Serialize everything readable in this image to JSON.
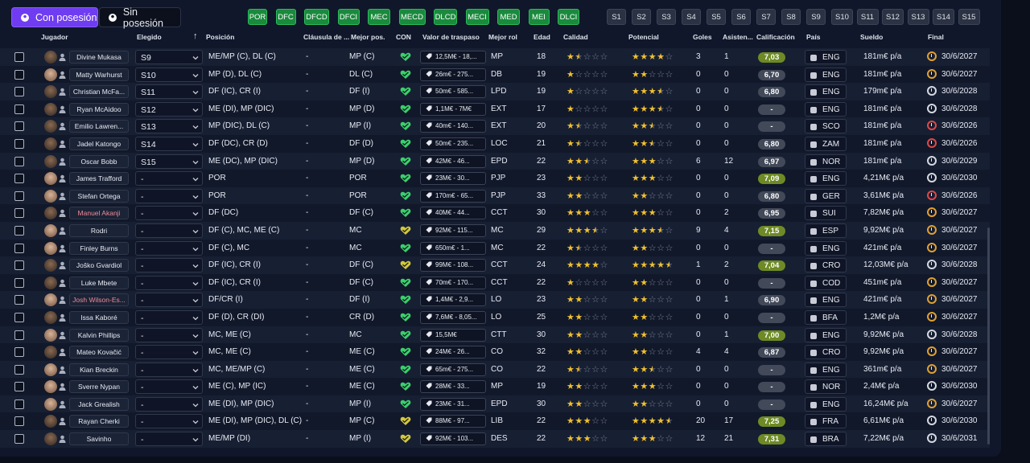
{
  "tabs": {
    "with_ball": "Con posesión",
    "without_ball": "Sin posesión"
  },
  "position_filters": [
    "POR",
    "DFC",
    "DFCD",
    "DFCI",
    "MEC",
    "MECD",
    "DLCD",
    "MECI",
    "MED",
    "MEI",
    "DLCI"
  ],
  "slot_filters": [
    "S1",
    "S2",
    "S3",
    "S4",
    "S5",
    "S6",
    "S7",
    "S8",
    "S9",
    "S10",
    "S11",
    "S12",
    "S13",
    "S14",
    "S15"
  ],
  "columns": {
    "player": "Jugador",
    "chosen": "Elegido",
    "position": "Posición",
    "clause": "Cláusula de ...",
    "best_pos": "Mejor pos.",
    "con": "CON",
    "value": "Valor de traspaso",
    "best_role": "Mejor rol",
    "age": "Edad",
    "quality": "Calidad",
    "potential": "Potencial",
    "goals": "Goles",
    "assists": "Asisten...",
    "rating": "Calificación",
    "country": "País",
    "wage": "Sueldo",
    "end": "Final"
  },
  "colors": {
    "accent": "#6f3cf1",
    "filter_green": "#1a8a3d",
    "heart_green": "#3ad06a",
    "heart_yellow": "#d2c83a",
    "star_gold": "#f0c030"
  },
  "players": [
    {
      "name": "Divine Mukasa",
      "chosen": "S9",
      "pos": "ME/MP (C), DL (C)",
      "clause": "-",
      "best": "MP (C)",
      "value": "12,5M€ - 18,...",
      "role": "MP",
      "age": "18",
      "q": "★½☆☆☆",
      "p": "★★★★☆",
      "g": "3",
      "a": "1",
      "rating": "7,03",
      "rc": "lime",
      "country": "ENG",
      "wage": "181m€ p/a",
      "end": "30/6/2027",
      "ec": "warn",
      "heart": "green",
      "light": false,
      "red": false
    },
    {
      "name": "Matty Warhurst",
      "chosen": "S10",
      "pos": "MP (D), DL (C)",
      "clause": "-",
      "best": "DL (C)",
      "value": "26m€ - 275...",
      "role": "DB",
      "age": "19",
      "q": "★☆☆☆☆",
      "p": "★★☆☆☆",
      "g": "0",
      "a": "0",
      "rating": "6,70",
      "rc": "gray",
      "country": "ENG",
      "wage": "181m€ p/a",
      "end": "30/6/2027",
      "ec": "warn",
      "heart": "green",
      "light": true,
      "red": false
    },
    {
      "name": "Christian McFa...",
      "chosen": "S11",
      "pos": "DF (IC), CR (I)",
      "clause": "-",
      "best": "DF (I)",
      "value": "50m€ - 585...",
      "role": "LPD",
      "age": "19",
      "q": "★☆☆☆☆",
      "p": "★★★½☆",
      "g": "0",
      "a": "0",
      "rating": "6,80",
      "rc": "gray",
      "country": "ENG",
      "wage": "179m€ p/a",
      "end": "30/6/2028",
      "ec": "",
      "heart": "green",
      "light": false,
      "red": false
    },
    {
      "name": "Ryan McAidoo",
      "chosen": "S12",
      "pos": "ME (DI), MP (DIC)",
      "clause": "-",
      "best": "MP (D)",
      "value": "1,1M€ - 7M€",
      "role": "EXT",
      "age": "17",
      "q": "★☆☆☆☆",
      "p": "★★★½☆",
      "g": "0",
      "a": "0",
      "rating": "-",
      "rc": "gray",
      "country": "ENG",
      "wage": "181m€ p/a",
      "end": "30/6/2028",
      "ec": "",
      "heart": "green",
      "light": false,
      "red": false
    },
    {
      "name": "Emilio Lawren...",
      "chosen": "S13",
      "pos": "MP (DIC), DL (C)",
      "clause": "-",
      "best": "MP (I)",
      "value": "40m€ - 140...",
      "role": "EXT",
      "age": "20",
      "q": "★½☆☆☆",
      "p": "★★½☆☆",
      "g": "0",
      "a": "0",
      "rating": "-",
      "rc": "gray",
      "country": "SCO",
      "wage": "181m€ p/a",
      "end": "30/6/2026",
      "ec": "bad",
      "heart": "green",
      "light": false,
      "red": false
    },
    {
      "name": "Jadel Katongo",
      "chosen": "S14",
      "pos": "DF (DC), CR (D)",
      "clause": "-",
      "best": "DF (D)",
      "value": "50m€ - 235...",
      "role": "LOC",
      "age": "21",
      "q": "★½☆☆☆",
      "p": "★★½☆☆",
      "g": "0",
      "a": "0",
      "rating": "6,80",
      "rc": "gray",
      "country": "ZAM",
      "wage": "181m€ p/a",
      "end": "30/6/2026",
      "ec": "bad",
      "heart": "green",
      "light": false,
      "red": false
    },
    {
      "name": "Oscar Bobb",
      "chosen": "S15",
      "pos": "ME (DC), MP (DIC)",
      "clause": "-",
      "best": "MP (D)",
      "value": "42M€ - 46...",
      "role": "EPD",
      "age": "22",
      "q": "★★½☆☆",
      "p": "★★★☆☆",
      "g": "6",
      "a": "12",
      "rating": "6,97",
      "rc": "gray",
      "country": "NOR",
      "wage": "181m€ p/a",
      "end": "30/6/2029",
      "ec": "",
      "heart": "green",
      "light": false,
      "red": false
    },
    {
      "name": "James Trafford",
      "chosen": "-",
      "pos": "POR",
      "clause": "-",
      "best": "POR",
      "value": "23M€ - 30...",
      "role": "PJP",
      "age": "23",
      "q": "★★☆☆☆",
      "p": "★★★☆☆",
      "g": "0",
      "a": "0",
      "rating": "7,09",
      "rc": "lime",
      "country": "ENG",
      "wage": "4,21M€ p/a",
      "end": "30/6/2030",
      "ec": "",
      "heart": "green",
      "light": true,
      "red": false
    },
    {
      "name": "Stefan Ortega",
      "chosen": "-",
      "pos": "POR",
      "clause": "-",
      "best": "POR",
      "value": "170m€ - 65...",
      "role": "PJP",
      "age": "33",
      "q": "★★☆☆☆",
      "p": "★★☆☆☆",
      "g": "0",
      "a": "0",
      "rating": "6,80",
      "rc": "gray",
      "country": "GER",
      "wage": "3,61M€ p/a",
      "end": "30/6/2026",
      "ec": "bad",
      "heart": "green",
      "light": true,
      "red": false
    },
    {
      "name": "Manuel Akanji",
      "chosen": "-",
      "pos": "DF (DC)",
      "clause": "-",
      "best": "DF (C)",
      "value": "40M€ - 44...",
      "role": "CCT",
      "age": "30",
      "q": "★★★☆☆",
      "p": "★★★☆☆",
      "g": "0",
      "a": "2",
      "rating": "6,95",
      "rc": "gray",
      "country": "SUI",
      "wage": "7,82M€ p/a",
      "end": "30/6/2027",
      "ec": "warn",
      "heart": "green",
      "light": false,
      "red": true
    },
    {
      "name": "Rodri",
      "chosen": "-",
      "pos": "DF (C), MC, ME (C)",
      "clause": "-",
      "best": "MC",
      "value": "92M€ - 115...",
      "role": "MC",
      "age": "29",
      "q": "★★★½☆",
      "p": "★★★½☆",
      "g": "9",
      "a": "4",
      "rating": "7,15",
      "rc": "lime",
      "country": "ESP",
      "wage": "9,92M€ p/a",
      "end": "30/6/2027",
      "ec": "warn",
      "heart": "yellow",
      "light": true,
      "red": false
    },
    {
      "name": "Finley Burns",
      "chosen": "-",
      "pos": "DF (C), MC",
      "clause": "-",
      "best": "MC",
      "value": "650m€ - 1...",
      "role": "MC",
      "age": "22",
      "q": "★½☆☆☆",
      "p": "★★☆☆☆",
      "g": "0",
      "a": "0",
      "rating": "-",
      "rc": "gray",
      "country": "ENG",
      "wage": "421m€ p/a",
      "end": "30/6/2027",
      "ec": "warn",
      "heart": "green",
      "light": true,
      "red": false
    },
    {
      "name": "Joško Gvardiol",
      "chosen": "-",
      "pos": "DF (IC), CR (I)",
      "clause": "-",
      "best": "DF (C)",
      "value": "99M€ - 108...",
      "role": "CCT",
      "age": "24",
      "q": "★★★★☆",
      "p": "★★★★½",
      "g": "1",
      "a": "2",
      "rating": "7,04",
      "rc": "lime",
      "country": "CRO",
      "wage": "12,03M€ p/a",
      "end": "30/6/2028",
      "ec": "",
      "heart": "yellow",
      "light": false,
      "red": false
    },
    {
      "name": "Luke Mbete",
      "chosen": "-",
      "pos": "DF (IC), CR (I)",
      "clause": "-",
      "best": "DF (C)",
      "value": "70m€ - 170...",
      "role": "CCT",
      "age": "22",
      "q": "★☆☆☆☆",
      "p": "★★☆☆☆",
      "g": "0",
      "a": "0",
      "rating": "-",
      "rc": "gray",
      "country": "COD",
      "wage": "451m€ p/a",
      "end": "30/6/2027",
      "ec": "warn",
      "heart": "green",
      "light": false,
      "red": false
    },
    {
      "name": "Josh Wilson-Es...",
      "chosen": "-",
      "pos": "DF/CR (I)",
      "clause": "-",
      "best": "DF (I)",
      "value": "1,4M€ - 2,9...",
      "role": "LO",
      "age": "23",
      "q": "★★☆☆☆",
      "p": "★★☆☆☆",
      "g": "0",
      "a": "1",
      "rating": "6,90",
      "rc": "gray",
      "country": "ENG",
      "wage": "421m€ p/a",
      "end": "30/6/2027",
      "ec": "warn",
      "heart": "green",
      "light": true,
      "red": true
    },
    {
      "name": "Issa Kaboré",
      "chosen": "-",
      "pos": "DF (D), CR (DI)",
      "clause": "-",
      "best": "CR (D)",
      "value": "7,6M€ - 8,05...",
      "role": "LO",
      "age": "25",
      "q": "★★☆☆☆",
      "p": "★★☆☆☆",
      "g": "0",
      "a": "0",
      "rating": "-",
      "rc": "gray",
      "country": "BFA",
      "wage": "1,2M€ p/a",
      "end": "30/6/2027",
      "ec": "warn",
      "heart": "green",
      "light": false,
      "red": false
    },
    {
      "name": "Kalvin Phillips",
      "chosen": "-",
      "pos": "MC, ME (C)",
      "clause": "-",
      "best": "MC",
      "value": "15,5M€",
      "role": "CTT",
      "age": "30",
      "q": "★★☆☆☆",
      "p": "★★☆☆☆",
      "g": "0",
      "a": "1",
      "rating": "7,00",
      "rc": "lime",
      "country": "ENG",
      "wage": "9,92M€ p/a",
      "end": "30/6/2028",
      "ec": "",
      "heart": "green",
      "light": true,
      "red": false
    },
    {
      "name": "Mateo Kovačić",
      "chosen": "-",
      "pos": "MC, ME (C)",
      "clause": "-",
      "best": "ME (C)",
      "value": "24M€ - 26...",
      "role": "CO",
      "age": "32",
      "q": "★★☆☆☆",
      "p": "★★☆☆☆",
      "g": "4",
      "a": "4",
      "rating": "6,87",
      "rc": "gray",
      "country": "CRO",
      "wage": "9,92M€ p/a",
      "end": "30/6/2027",
      "ec": "warn",
      "heart": "green",
      "light": false,
      "red": false
    },
    {
      "name": "Kian Breckin",
      "chosen": "-",
      "pos": "MC, ME/MP (C)",
      "clause": "-",
      "best": "ME (C)",
      "value": "65m€ - 275...",
      "role": "CO",
      "age": "22",
      "q": "★½☆☆☆",
      "p": "★★½☆☆",
      "g": "0",
      "a": "0",
      "rating": "-",
      "rc": "gray",
      "country": "ENG",
      "wage": "361m€ p/a",
      "end": "30/6/2027",
      "ec": "warn",
      "heart": "green",
      "light": true,
      "red": false
    },
    {
      "name": "Sverre Nypan",
      "chosen": "-",
      "pos": "ME (C), MP (IC)",
      "clause": "-",
      "best": "ME (C)",
      "value": "28M€ - 33...",
      "role": "MP",
      "age": "19",
      "q": "★★☆☆☆",
      "p": "★★★☆☆",
      "g": "0",
      "a": "0",
      "rating": "-",
      "rc": "gray",
      "country": "NOR",
      "wage": "2,4M€ p/a",
      "end": "30/6/2030",
      "ec": "",
      "heart": "green",
      "light": true,
      "red": false
    },
    {
      "name": "Jack Grealish",
      "chosen": "-",
      "pos": "ME (DI), MP (DIC)",
      "clause": "-",
      "best": "MP (I)",
      "value": "23M€ - 31...",
      "role": "EPD",
      "age": "30",
      "q": "★★☆☆☆",
      "p": "★★☆☆☆",
      "g": "0",
      "a": "0",
      "rating": "-",
      "rc": "gray",
      "country": "ENG",
      "wage": "16,24M€ p/a",
      "end": "30/6/2027",
      "ec": "warn",
      "heart": "green",
      "light": true,
      "red": false
    },
    {
      "name": "Rayan Cherki",
      "chosen": "-",
      "pos": "ME (DI), MP (DIC), DL (C)",
      "clause": "-",
      "best": "MP (C)",
      "value": "88M€ - 97...",
      "role": "LIB",
      "age": "22",
      "q": "★★★☆☆",
      "p": "★★★★½",
      "g": "20",
      "a": "17",
      "rating": "7,25",
      "rc": "lime",
      "country": "FRA",
      "wage": "6,61M€ p/a",
      "end": "30/6/2030",
      "ec": "",
      "heart": "yellow",
      "light": false,
      "red": false
    },
    {
      "name": "Savinho",
      "chosen": "-",
      "pos": "ME/MP (DI)",
      "clause": "-",
      "best": "MP (I)",
      "value": "92M€ - 103...",
      "role": "DES",
      "age": "22",
      "q": "★★★☆☆",
      "p": "★★★☆☆",
      "g": "12",
      "a": "21",
      "rating": "7,31",
      "rc": "lime",
      "country": "BRA",
      "wage": "7,22M€ p/a",
      "end": "30/6/2031",
      "ec": "",
      "heart": "yellow",
      "light": false,
      "red": false
    }
  ]
}
